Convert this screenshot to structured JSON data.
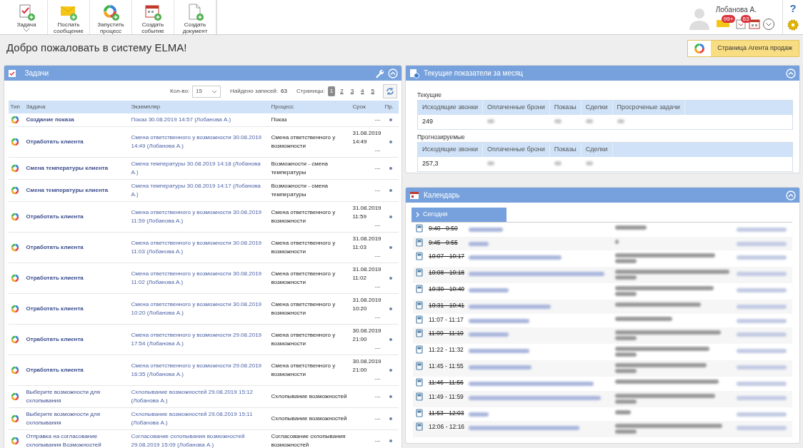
{
  "toolbar": {
    "buttons": [
      {
        "kind": "task",
        "label": "Задача",
        "has_menu": true
      },
      {
        "kind": "message",
        "label": "Послать сообщение"
      },
      {
        "kind": "process",
        "label": "Запустить процесс"
      },
      {
        "kind": "event",
        "label": "Создать событие"
      },
      {
        "kind": "document",
        "label": "Создать документ"
      }
    ]
  },
  "user": {
    "name": "Лобанова А.",
    "messages_badge": "99+",
    "tasks_badge": "63"
  },
  "help": "?",
  "welcome": "Добро пожаловать в систему ELMA!",
  "agent_button": "Страница Агента продаж",
  "tasks": {
    "title": "Задачи",
    "count_label": "Кол-во:",
    "count_value": "15",
    "found_label": "Найдено записей:",
    "found_value": "63",
    "pages_label": "Страницы:",
    "pages": [
      {
        "label": "1",
        "selected": true
      },
      {
        "label": "2",
        "selected": false
      },
      {
        "label": "3",
        "selected": false
      },
      {
        "label": "4",
        "selected": false
      },
      {
        "label": "5",
        "selected": false
      }
    ],
    "columns": [
      "Тип",
      "Задача",
      "Экземпляр",
      "Процесс",
      "Срок",
      "Пр."
    ],
    "rows": [
      {
        "task": "Создание показа",
        "unread": true,
        "instance": "Показ 30.08.2019 14:57 (Лобанова А.)",
        "process": "Показ",
        "end": "---"
      },
      {
        "task": "Отработать клиента",
        "unread": true,
        "instance": "Смена ответственного у возможности 30.08.2019 14:49 (Лобанова А.)",
        "process": "Смена ответственного у возможности",
        "due": "31.08.2019 14:49",
        "end": "---"
      },
      {
        "task": "Смена температуры клиента",
        "unread": true,
        "instance": "Смена температуры 30.08.2019 14:18 (Лобанова А.)",
        "process": "Возможности - смена температуры",
        "end": "---"
      },
      {
        "task": "Смена температуры клиента",
        "unread": true,
        "instance": "Смена температуры 30.08.2019 14:17 (Лобанова А.)",
        "process": "Возможности - смена температуры",
        "end": "---"
      },
      {
        "task": "Отработать клиента",
        "unread": true,
        "instance": "Смена ответственного у возможности 30.08.2019 11:59 (Лобанова А.)",
        "process": "Смена ответственного у возможности",
        "due": "31.08.2019 11:59",
        "end": "---"
      },
      {
        "task": "Отработать клиента",
        "unread": true,
        "instance": "Смена ответственного у возможности 30.08.2019 11:03 (Лобанова А.)",
        "process": "Смена ответственного у возможности",
        "due": "31.08.2019 11:03",
        "end": "---"
      },
      {
        "task": "Отработать клиента",
        "unread": true,
        "instance": "Смена ответственного у возможности 30.08.2019 11:02 (Лобанова А.)",
        "process": "Смена ответственного у возможности",
        "due": "31.08.2019 11:02",
        "end": "---"
      },
      {
        "task": "Отработать клиента",
        "unread": true,
        "instance": "Смена ответственного у возможности 30.08.2019 10:20 (Лобанова А.)",
        "process": "Смена ответственного у возможности",
        "due": "31.08.2019 10:20",
        "end": "---"
      },
      {
        "task": "Отработать клиента",
        "unread": true,
        "instance": "Смена ответственного у возможности 29.08.2019 17:54 (Лобанова А.)",
        "process": "Смена ответственного у возможности",
        "due": "30.08.2019 21:00",
        "end": "---"
      },
      {
        "task": "Отработать клиента",
        "unread": true,
        "instance": "Смена ответственного у возможности 29.08.2019 16:35 (Лобанова А.)",
        "process": "Смена ответственного у возможности",
        "due": "30.08.2019 21:00",
        "end": "---"
      },
      {
        "task": "Выберите возможности для схлопывания",
        "unread": false,
        "instance": "Схлопывание возможностей 29.08.2019 15:12 (Лобанова А.)",
        "process": "Схлопывание возможностей",
        "end": "---"
      },
      {
        "task": "Выберите возможности для схлопывания",
        "unread": false,
        "instance": "Схлопывание возможностей 29.08.2019 15:11 (Лобанова А.)",
        "process": "Схлопывание возможностей",
        "end": "---"
      },
      {
        "task": "Отправка на согласование схлопывания Возможностей",
        "unread": false,
        "instance": "Согласование схлопывания возможностей 29.08.2019 15:09 (Лобанова А.)",
        "process": "Согласование схлопывания возможностей",
        "end": "---"
      }
    ]
  },
  "metrics": {
    "title": "Текущие показатели за месяц",
    "sections": [
      {
        "label": "Текущие",
        "columns": [
          "Исходящие звонки",
          "Оплаченные брони",
          "Показы",
          "Сделки",
          "Просроченые задачи"
        ],
        "cells": [
          {
            "kind": "text",
            "text": "249"
          },
          {
            "kind": "blurred"
          },
          {
            "kind": "blurred"
          },
          {
            "kind": "blurred"
          },
          {
            "kind": "blurred"
          }
        ]
      },
      {
        "label": "Прогнозируемые",
        "columns": [
          "Исходящие звонки",
          "Оплаченные брони",
          "Показы",
          "Сделки"
        ],
        "cells": [
          {
            "kind": "text",
            "text": "257,3"
          },
          {
            "kind": "blurred"
          },
          {
            "kind": "blurred"
          },
          {
            "kind": "blurred"
          }
        ]
      }
    ]
  },
  "calendar": {
    "title": "Календарь",
    "tab": "Сегодня",
    "events": [
      {
        "time": "9:40 - 9:50",
        "done": true,
        "wrapped": false
      },
      {
        "time": "9:45 - 9:55",
        "done": true,
        "wrapped": false
      },
      {
        "time": "10:07 - 10:17",
        "done": true,
        "wrapped": true
      },
      {
        "time": "10:08 - 10:18",
        "done": true,
        "wrapped": true
      },
      {
        "time": "10:30 - 10:40",
        "done": true,
        "wrapped": true
      },
      {
        "time": "10:31 - 10:41",
        "done": true,
        "wrapped": false
      },
      {
        "time": "11:07 - 11:17",
        "done": false,
        "wrapped": false
      },
      {
        "time": "11:09 - 11:19",
        "done": true,
        "wrapped": true
      },
      {
        "time": "11:22 - 11:32",
        "done": false,
        "wrapped": true
      },
      {
        "time": "11:45 - 11:55",
        "done": false,
        "wrapped": true
      },
      {
        "time": "11:46 - 11:56",
        "done": true,
        "wrapped": false
      },
      {
        "time": "11:49 - 11:59",
        "done": false,
        "wrapped": true
      },
      {
        "time": "11:53 - 12:03",
        "done": true,
        "wrapped": false
      },
      {
        "time": "12:06 - 12:16",
        "done": false,
        "wrapped": true
      }
    ]
  }
}
